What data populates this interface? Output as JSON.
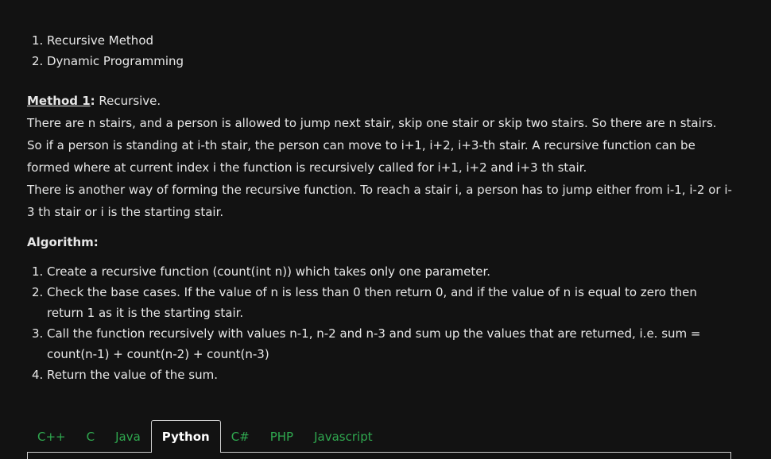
{
  "methods_list": [
    {
      "num": "1.",
      "text": "Recursive Method"
    },
    {
      "num": "2.",
      "text": "Dynamic Programming"
    }
  ],
  "method1": {
    "label": "Method 1",
    "separator": ":",
    "title": " Recursive."
  },
  "paragraphs": [
    "There are n stairs, and a person is allowed to jump next stair, skip one stair or skip two stairs. So there are n stairs. So if a person is standing at i-th stair, the person can move to i+1, i+2, i+3-th stair. A recursive function can be formed where at current index i the function is recursively called for i+1, i+2 and i+3 th stair.",
    "There is another way of forming the recursive function. To reach a stair i, a person has to jump either from i-1, i-2 or i-3 th stair or i is the starting stair."
  ],
  "algorithm": {
    "heading": "Algorithm:",
    "steps": [
      {
        "num": "1.",
        "text": "Create a recursive function (count(int n)) which takes only one parameter."
      },
      {
        "num": "2.",
        "text": "Check the base cases. If the value of n is less than 0 then return 0, and if the value of n is equal to zero then return 1 as it is the starting stair."
      },
      {
        "num": "3.",
        "text": "Call the function recursively with values n-1, n-2 and n-3 and sum up the values that are returned, i.e. sum = count(n-1) + count(n-2) + count(n-3)"
      },
      {
        "num": "4.",
        "text": "Return the value of the sum."
      }
    ]
  },
  "tabs": [
    {
      "label": "C++",
      "active": false
    },
    {
      "label": "C",
      "active": false
    },
    {
      "label": "Java",
      "active": false
    },
    {
      "label": "Python",
      "active": true
    },
    {
      "label": "C#",
      "active": false
    },
    {
      "label": "PHP",
      "active": false
    },
    {
      "label": "Javascript",
      "active": false
    }
  ],
  "colors": {
    "background": "#121212",
    "text": "#e6e6e6",
    "tab_inactive": "#2fa84f",
    "tab_active": "#ffffff",
    "border": "#cfcfcf"
  }
}
